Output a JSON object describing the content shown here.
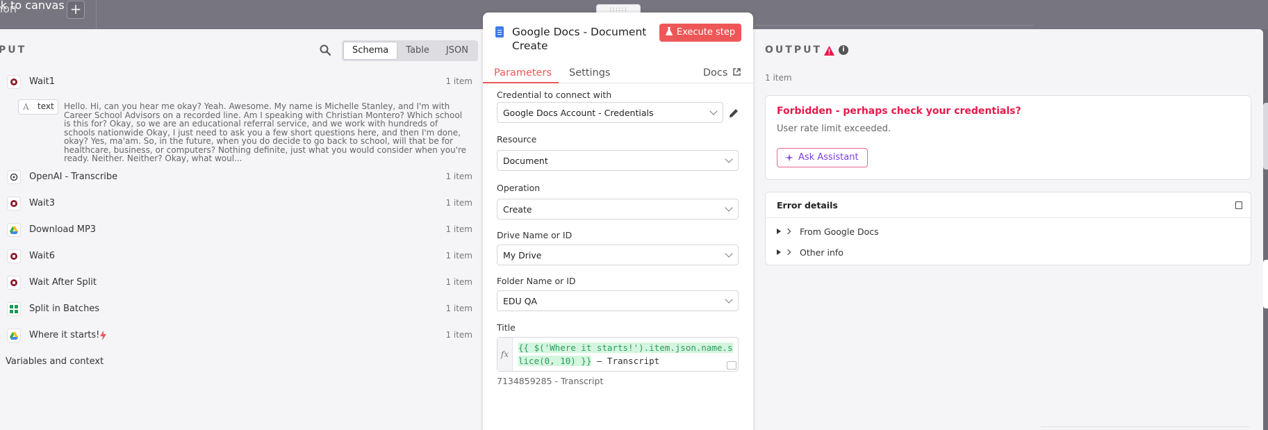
{
  "topbar": {
    "back_label": "ck to canvas",
    "sub_label": "non",
    "plus": "+"
  },
  "input": {
    "section_title": "PUT",
    "view_toggle": [
      "Schema",
      "Table",
      "JSON"
    ],
    "nodes": [
      {
        "name": "Wait1",
        "count": "1 item",
        "icon": "wait-icon"
      },
      {
        "name": "OpenAI - Transcribe",
        "count": "1 item",
        "icon": "openai-icon"
      },
      {
        "name": "Wait3",
        "count": "1 item",
        "icon": "wait-icon"
      },
      {
        "name": "Download MP3",
        "count": "1 item",
        "icon": "google-drive-icon"
      },
      {
        "name": "Wait6",
        "count": "1 item",
        "icon": "wait-icon"
      },
      {
        "name": "Wait After Split",
        "count": "1 item",
        "icon": "wait-icon"
      },
      {
        "name": "Split in Batches",
        "count": "1 item",
        "icon": "split-batches-icon"
      },
      {
        "name": "Where it starts!",
        "count": "1 item",
        "icon": "google-drive-icon"
      }
    ],
    "field": {
      "type_glyph": "A",
      "name": "text",
      "value": "Hello. Hi, can you hear me okay? Yeah. Awesome. My name is Michelle Stanley, and I'm with Career School Advisors on a recorded line. Am I speaking with Christian Montero? Which school is this for? Okay, so we are an educational referral service, and we work with hundreds of schools nationwide Okay, I just need to ask you a few short questions here, and then I'm done, okay? Yes, ma'am. So, in the future, when you do decide to go back to school, will that be for healthcare, business, or computers? Nothing definite, just what you would consider when you're ready. Neither. Neither? Okay, what woul..."
    },
    "variables_label": "Variables and context"
  },
  "node": {
    "title": "Google Docs - Document Create",
    "execute_label": "Execute step",
    "tabs": {
      "parameters": "Parameters",
      "settings": "Settings",
      "docs": "Docs"
    },
    "params": {
      "credential": {
        "label": "Credential to connect with",
        "value": "Google Docs Account - Credentials"
      },
      "resource": {
        "label": "Resource",
        "value": "Document"
      },
      "operation": {
        "label": "Operation",
        "value": "Create"
      },
      "drive": {
        "label": "Drive Name or ID",
        "value": "My Drive"
      },
      "folder": {
        "label": "Folder Name or ID",
        "value": "EDU QA"
      },
      "title": {
        "label": "Title",
        "fx": "fx",
        "expression": "{{ $('Where it starts!').item.json.name.slice(0, 10) }}",
        "suffix": " – Transcript",
        "result": "7134859285 - Transcript"
      }
    }
  },
  "output": {
    "section_title": "OUTPUT",
    "count": "1 item",
    "error": {
      "title": "Forbidden - perhaps check your credentials?",
      "message": "User rate limit exceeded.",
      "assist_label": "Ask Assistant"
    },
    "details": {
      "title": "Error details",
      "rows": [
        "From Google Docs",
        "Other info"
      ]
    }
  },
  "colors": {
    "accent": "#ee5757",
    "error_text": "#e6194b",
    "assistant": "#7b3fe4",
    "wait_node": "#8b1a2b"
  }
}
